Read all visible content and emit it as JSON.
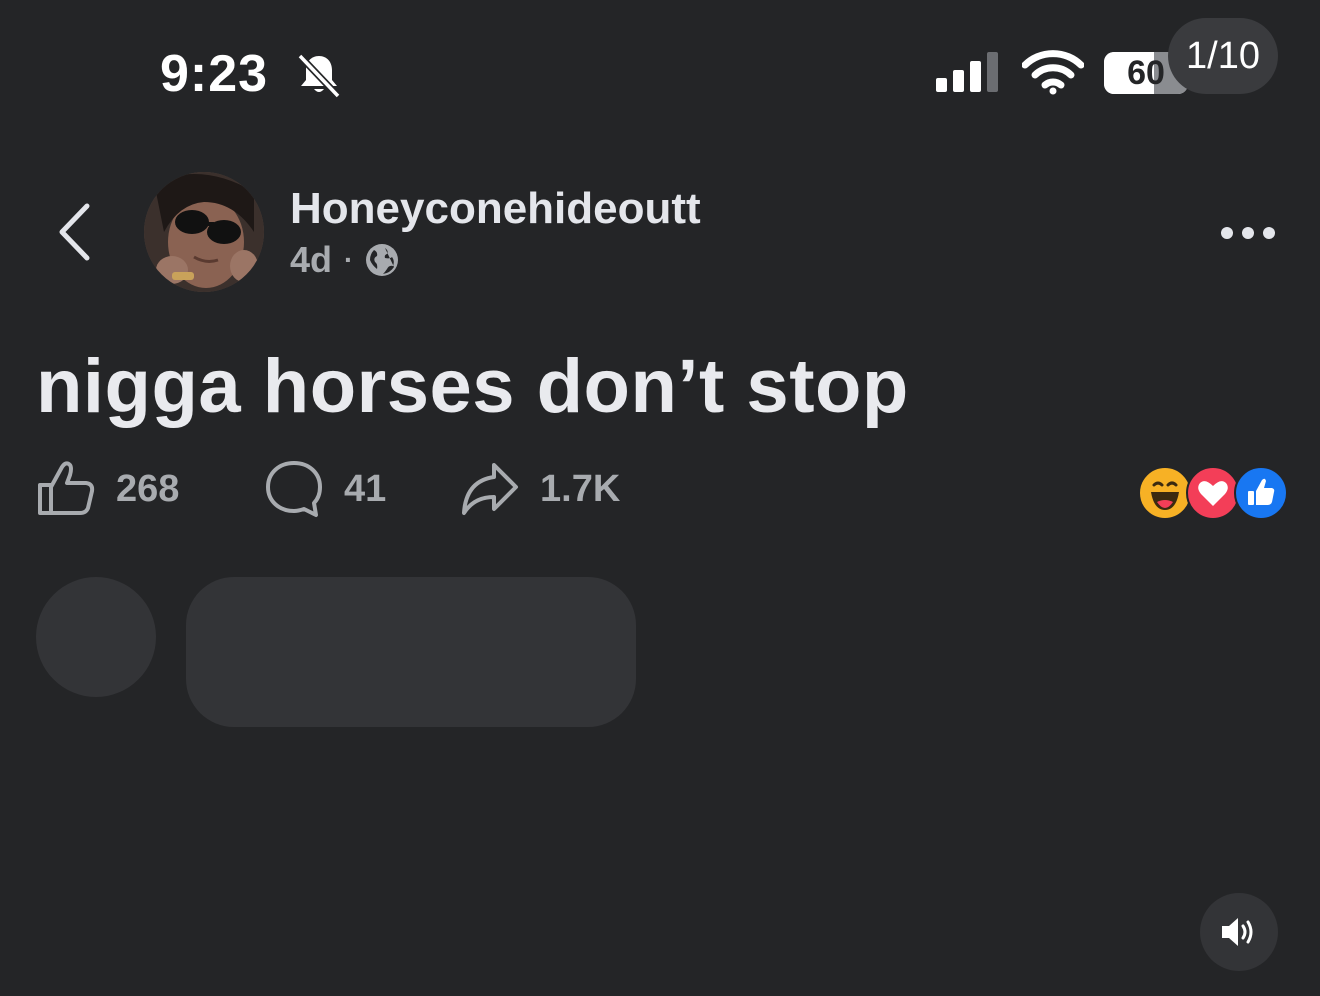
{
  "status_bar": {
    "time": "9:23",
    "battery_level": "60",
    "battery_fraction": 0.6,
    "silent_icon": "bell-slash-icon",
    "signal_icon": "cellular-signal-icon",
    "wifi_icon": "wifi-icon"
  },
  "viewer": {
    "page_counter": "1/10"
  },
  "post": {
    "author": "Honeyconehideoutt",
    "age": "4d",
    "separator": "·",
    "audience_icon": "globe-icon",
    "text": "nigga horses don’t stop"
  },
  "actions": {
    "likes": "268",
    "comments": "41",
    "shares": "1.7K"
  },
  "reactions": [
    "haha",
    "love",
    "like"
  ],
  "colors": {
    "background": "#242527",
    "like_blue": "#1877f2",
    "love_red": "#f33e58",
    "haha_yellow": "#f7b125"
  }
}
